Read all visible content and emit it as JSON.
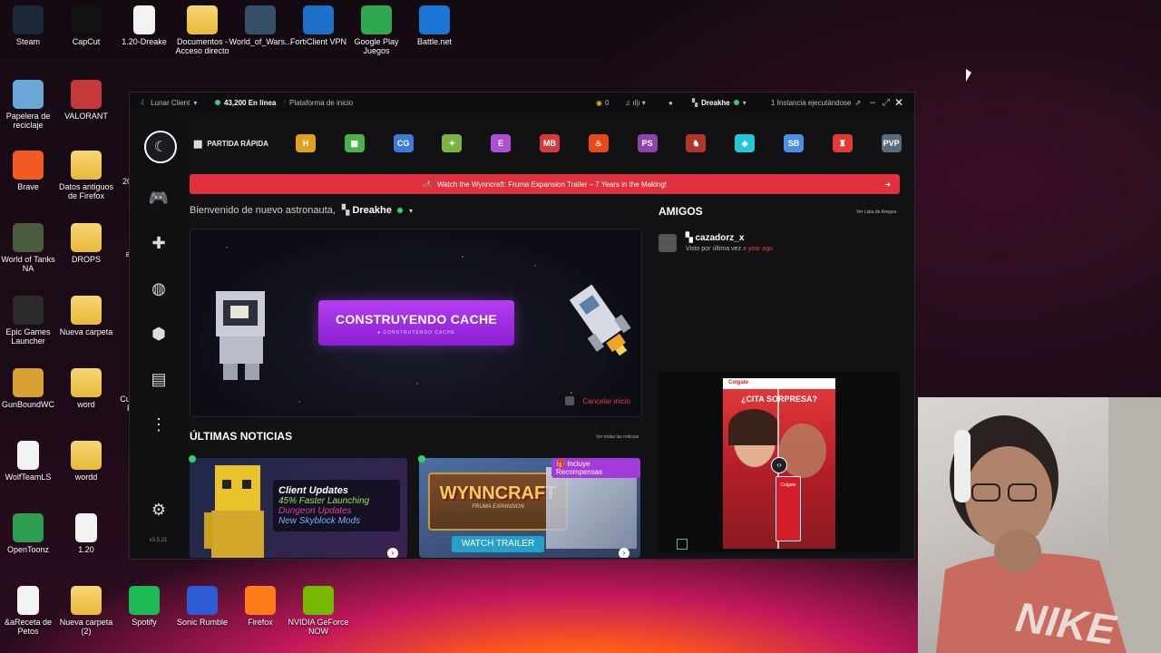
{
  "desktop": {
    "icons": [
      {
        "label": "Steam"
      },
      {
        "label": "CapCut"
      },
      {
        "label": "1.20-Dreake"
      },
      {
        "label": "Documentos - Acceso directo"
      },
      {
        "label": "World_of_Wars..."
      },
      {
        "label": "FortiClient VPN"
      },
      {
        "label": "Google Play Juegos"
      },
      {
        "label": "Battle.net"
      },
      {
        "label": "Papelera de reciclaje"
      },
      {
        "label": "VALORANT"
      },
      {
        "label": "Brave"
      },
      {
        "label": "Datos antiguos de Firefox"
      },
      {
        "label": "World of Tanks NA"
      },
      {
        "label": "DROPS"
      },
      {
        "label": "Epic Games Launcher"
      },
      {
        "label": "Nueva carpeta"
      },
      {
        "label": "GunBoundWC"
      },
      {
        "label": "word"
      },
      {
        "label": "WolfTeamLS"
      },
      {
        "label": "wordd"
      },
      {
        "label": "OpenToonz"
      },
      {
        "label": "1.20"
      },
      {
        "label": "&aReceta de Petos"
      },
      {
        "label": "Nueva carpeta (2)"
      },
      {
        "label": "Spotify"
      },
      {
        "label": "Sonic Rumble"
      },
      {
        "label": "Firefox"
      },
      {
        "label": "NVIDIA GeForce NOW"
      }
    ],
    "partial_labels": [
      "20",
      "a",
      "Cu",
      "P"
    ]
  },
  "launcher": {
    "title": "Lunar Client",
    "online_count": "43,200 En línea",
    "platform": "Plataforma de inicio",
    "coins": "0",
    "username": "Dreakhe",
    "instance": "1 Instancia ejecutándose",
    "version": "v3.5.21",
    "quick_play": "PARTIDA RÁPIDA",
    "games": [
      {
        "icon": "H",
        "color": "#e0a020"
      },
      {
        "icon": "▦",
        "color": "#4caf50"
      },
      {
        "icon": "CG",
        "color": "#3d7bd8"
      },
      {
        "icon": "✦",
        "color": "#7cb342"
      },
      {
        "icon": "E",
        "color": "#b04fd6"
      },
      {
        "icon": "MB",
        "color": "#d33b3b"
      },
      {
        "icon": "♨",
        "color": "#e64a19"
      },
      {
        "icon": "PS",
        "color": "#8e44ad"
      },
      {
        "icon": "♞",
        "color": "#b0362f"
      },
      {
        "icon": "◆",
        "color": "#26c6da"
      },
      {
        "icon": "SB",
        "color": "#4a90e2"
      },
      {
        "icon": "♜",
        "color": "#e53935"
      },
      {
        "icon": "PVP",
        "color": "#5c6b7a"
      }
    ],
    "banner_text": "Watch the Wynncraft: Fruma Expansion Trailer – 7 Years in the Making!",
    "welcome": "Bienvenido de nuevo astronauta,",
    "hero": {
      "button": "CONSTRUYENDO CACHE",
      "sub": "CONSTRUYENDO CACHE",
      "cancel": "Cancelar inicio"
    },
    "news": {
      "heading": "ÚLTIMAS NOTICIAS",
      "see_all": "Ver todas las noticias",
      "cards": [
        {
          "lines": [
            "Client Updates",
            "45% Faster Launching",
            "Dungeon Updates",
            "New Skyblock Mods"
          ]
        },
        {
          "badge": "Incluye Recompensas",
          "logo": "WYNNCRAFT",
          "sub": "FRUMA EXPANSION",
          "cta": "WATCH TRAILER"
        }
      ]
    },
    "friends": {
      "heading": "AMIGOS",
      "list_link": "Ver Lista de Amigos",
      "items": [
        {
          "name": "cazadorz_x",
          "status": "Visto por última vez",
          "ago": "a year ago"
        }
      ]
    },
    "ad": {
      "headline": "¿CITA SORPRESA?",
      "brand": "Colgate"
    }
  },
  "webcam": {
    "shirt_text": "NIKE"
  },
  "colors": {
    "accent": "#e0313e",
    "purple": "#9b2fe0",
    "online": "#33d16b"
  }
}
